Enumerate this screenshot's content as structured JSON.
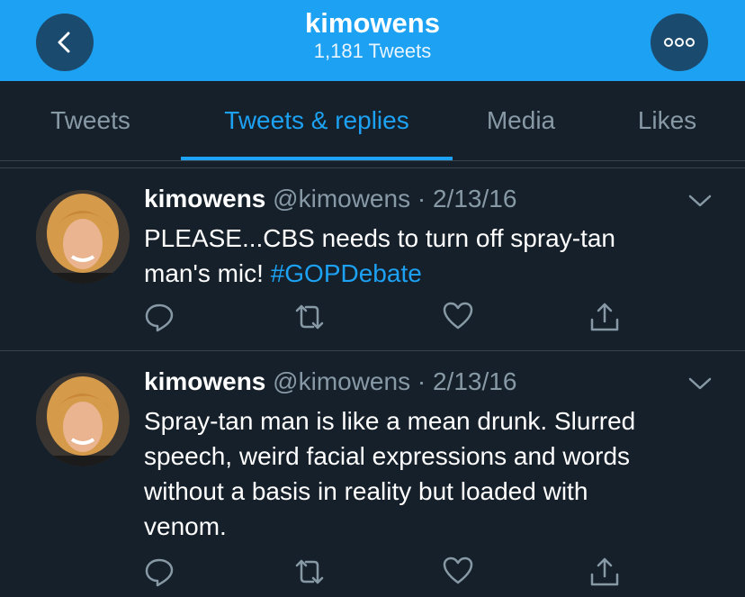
{
  "header": {
    "title": "kimowens",
    "subtitle": "1,181 Tweets",
    "back_icon": "chevron-left-icon",
    "more_icon": "more-horizontal-icon",
    "background_color": "#1da1f2"
  },
  "tabs": [
    {
      "label": "Tweets",
      "active": false
    },
    {
      "label": "Tweets & replies",
      "active": true
    },
    {
      "label": "Media",
      "active": false
    },
    {
      "label": "Likes",
      "active": false
    }
  ],
  "tweets": [
    {
      "name": "kimowens",
      "handle": "@kimowens",
      "separator": " · ",
      "date": "2/13/16",
      "lines": [
        "PLEASE...CBS needs to turn off spray-tan",
        "man's mic! "
      ],
      "hashtag": "#GOPDebate"
    },
    {
      "name": "kimowens",
      "handle": "@kimowens",
      "separator": " · ",
      "date": "2/13/16",
      "lines": [
        "Spray-tan man is like a mean drunk. Slurred",
        "speech, weird facial expressions and words",
        "without a basis in reality but loaded with",
        "venom."
      ]
    }
  ],
  "colors": {
    "background": "#15202b",
    "accent": "#1da1f2",
    "secondary_text": "#8899a6",
    "divider": "#38444d"
  },
  "action_icons": [
    "reply-icon",
    "retweet-icon",
    "like-icon",
    "share-icon"
  ]
}
